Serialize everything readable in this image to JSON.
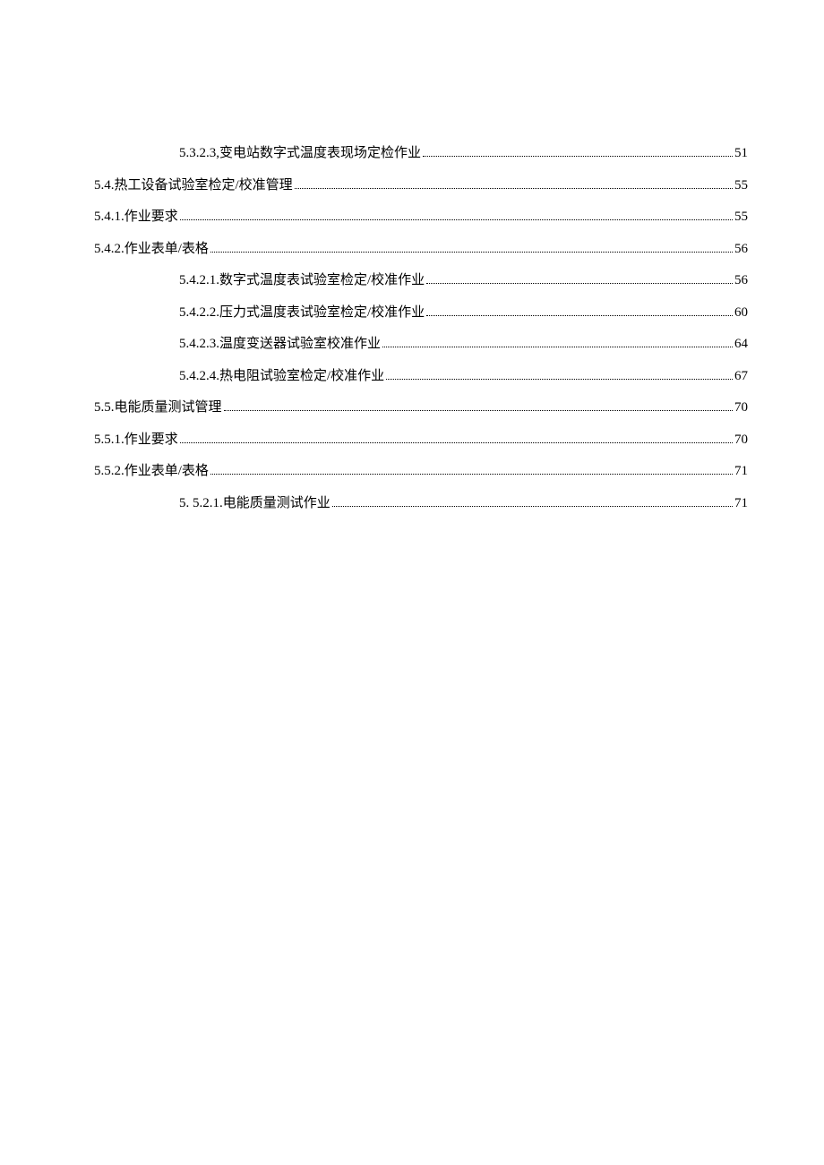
{
  "toc": [
    {
      "indent": "indent-1",
      "label": "5.3.2.3,变电站数字式温度表现场定检作业",
      "page": "51"
    },
    {
      "indent": "indent-0",
      "label": "5.4.热工设备试验室检定/校准管理",
      "page": "55"
    },
    {
      "indent": "indent-0",
      "label": "5.4.1.作业要求",
      "page": " 55"
    },
    {
      "indent": "indent-0",
      "label": "5.4.2.作业表单/表格",
      "page": " 56"
    },
    {
      "indent": "indent-1",
      "label": "5.4.2.1.数字式温度表试验室检定/校准作业",
      "page": "56"
    },
    {
      "indent": "indent-1",
      "label": "5.4.2.2.压力式温度表试验室检定/校准作业",
      "page": "60"
    },
    {
      "indent": "indent-1",
      "label": "5.4.2.3.温度变送器试验室校准作业",
      "page": " 64"
    },
    {
      "indent": "indent-1",
      "label": "5.4.2.4.热电阻试验室检定/校准作业",
      "page": "67"
    },
    {
      "indent": "indent-0",
      "label": "5.5.电能质量测试管理",
      "page": "70"
    },
    {
      "indent": "indent-0",
      "label": "5.5.1.作业要求",
      "page": " 70"
    },
    {
      "indent": "indent-0",
      "label": "5.5.2.作业表单/表格",
      "page": " 71"
    },
    {
      "indent": "indent-2",
      "label": "5.  5.2.1.电能质量测试作业",
      "page": " 71"
    }
  ]
}
